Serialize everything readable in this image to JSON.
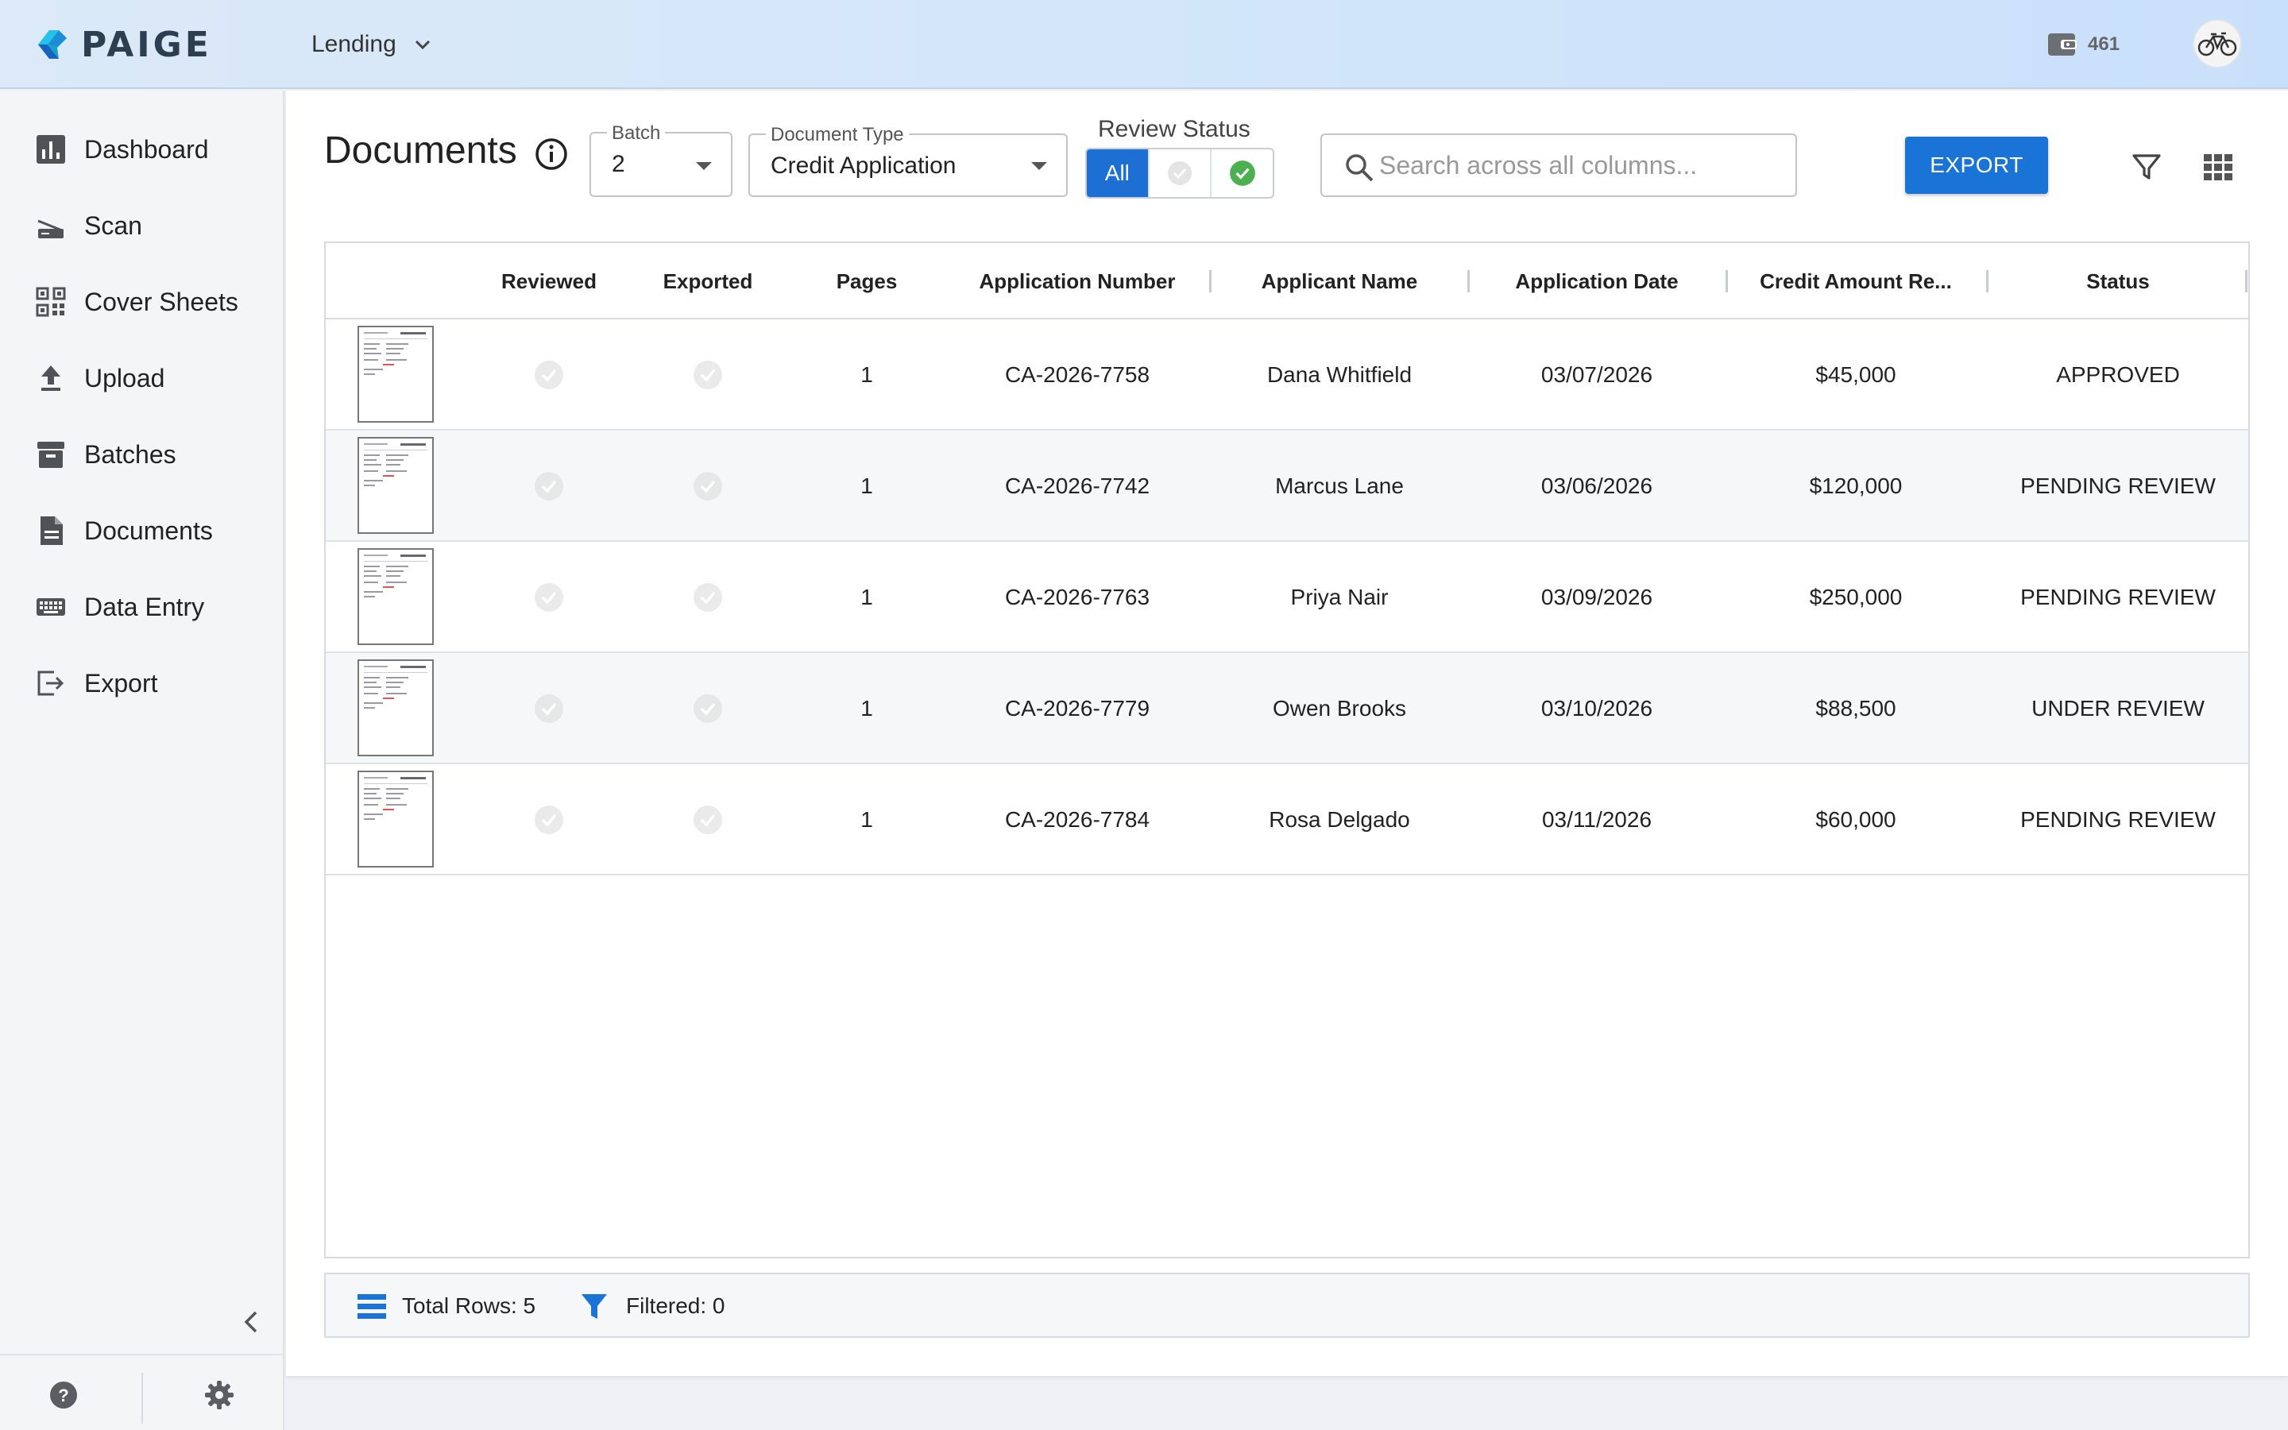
{
  "header": {
    "brand": "PAIGE",
    "app_switcher": "Lending",
    "credits": "461",
    "icons": {
      "logo": "paige-logo",
      "credits": "wallet-icon",
      "avatar": "bicycle-avatar",
      "switcher": "chevron-down-icon"
    }
  },
  "sidebar": {
    "items": [
      {
        "label": "Dashboard",
        "icon": "bar-chart-icon"
      },
      {
        "label": "Scan",
        "icon": "scanner-icon"
      },
      {
        "label": "Cover Sheets",
        "icon": "qr-code-icon"
      },
      {
        "label": "Upload",
        "icon": "upload-icon"
      },
      {
        "label": "Batches",
        "icon": "archive-box-icon"
      },
      {
        "label": "Documents",
        "icon": "document-icon"
      },
      {
        "label": "Data Entry",
        "icon": "keyboard-icon"
      },
      {
        "label": "Export",
        "icon": "export-icon"
      }
    ],
    "footer_icons": [
      "help-icon",
      "gear-icon",
      "chevron-left-icon"
    ]
  },
  "toolbar": {
    "title": "Documents",
    "batch_label": "Batch",
    "batch_value": "2",
    "doc_type_label": "Document Type",
    "doc_type_value": "Credit Application",
    "review_status_label": "Review Status",
    "review_options": [
      "All",
      "unreviewed",
      "reviewed"
    ],
    "review_selected": "All",
    "search_placeholder": "Search across all columns...",
    "export_label": "EXPORT"
  },
  "table": {
    "columns": [
      "",
      "Reviewed",
      "Exported",
      "Pages",
      "Application Number",
      "Applicant Name",
      "Application Date",
      "Credit Amount Re...",
      "Status"
    ],
    "rows": [
      {
        "reviewed": false,
        "exported": false,
        "pages": "1",
        "app_number": "CA-2026-7758",
        "name": "Dana Whitfield",
        "date": "03/07/2026",
        "amount": "$45,000",
        "status": "APPROVED"
      },
      {
        "reviewed": false,
        "exported": false,
        "pages": "1",
        "app_number": "CA-2026-7742",
        "name": "Marcus Lane",
        "date": "03/06/2026",
        "amount": "$120,000",
        "status": "PENDING REVIEW"
      },
      {
        "reviewed": false,
        "exported": false,
        "pages": "1",
        "app_number": "CA-2026-7763",
        "name": "Priya Nair",
        "date": "03/09/2026",
        "amount": "$250,000",
        "status": "PENDING REVIEW"
      },
      {
        "reviewed": false,
        "exported": false,
        "pages": "1",
        "app_number": "CA-2026-7779",
        "name": "Owen Brooks",
        "date": "03/10/2026",
        "amount": "$88,500",
        "status": "UNDER REVIEW"
      },
      {
        "reviewed": false,
        "exported": false,
        "pages": "1",
        "app_number": "CA-2026-7784",
        "name": "Rosa Delgado",
        "date": "03/11/2026",
        "amount": "$60,000",
        "status": "PENDING REVIEW"
      }
    ]
  },
  "status_bar": {
    "total_rows": "Total Rows: 5",
    "filtered": "Filtered: 0"
  },
  "colors": {
    "accent": "#1a73d6",
    "reviewed_check": "#4caf50",
    "inactive_check": "#dcdcdc"
  }
}
